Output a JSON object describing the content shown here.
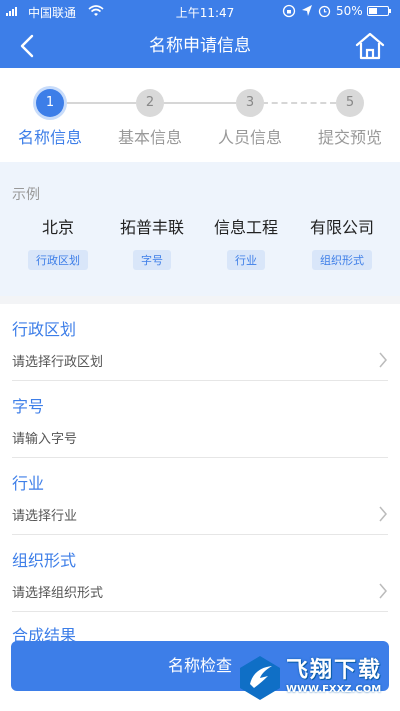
{
  "status_bar": {
    "carrier": "中国联通",
    "time": "上午11:47",
    "battery": "50%",
    "battery_level": 0.5
  },
  "nav": {
    "title": "名称申请信息",
    "back_icon": "chevron-left-icon",
    "home_icon": "home-icon"
  },
  "steps": [
    {
      "number": "1",
      "label": "名称信息",
      "active": true
    },
    {
      "number": "2",
      "label": "基本信息",
      "active": false
    },
    {
      "number": "3",
      "label": "人员信息",
      "active": false
    },
    {
      "number": "5",
      "label": "提交预览",
      "active": false
    }
  ],
  "example": {
    "title": "示例",
    "items": [
      {
        "word": "北京",
        "tag": "行政区划"
      },
      {
        "word": "拓普丰联",
        "tag": "字号"
      },
      {
        "word": "信息工程",
        "tag": "行业"
      },
      {
        "word": "有限公司",
        "tag": "组织形式"
      }
    ]
  },
  "form": {
    "fields": [
      {
        "label": "行政区划",
        "value": "请选择行政区划",
        "has_arrow": true
      },
      {
        "label": "字号",
        "value": "请输入字号",
        "has_arrow": false
      },
      {
        "label": "行业",
        "value": "请选择行业",
        "has_arrow": true
      },
      {
        "label": "组织形式",
        "value": "请选择组织形式",
        "has_arrow": true
      }
    ],
    "result_label": "合成结果"
  },
  "check_button": {
    "label": "名称检查"
  },
  "watermark": {
    "title": "飞翔下载",
    "url": "WWW.FXXZ.COM"
  },
  "colors": {
    "accent": "#3d7ee8",
    "example_bg": "#eef4fc",
    "tag_bg": "#d9e6f9"
  }
}
